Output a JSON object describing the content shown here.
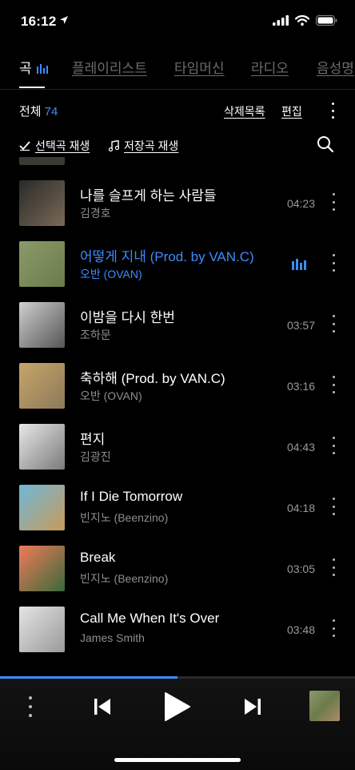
{
  "status": {
    "time": "16:12"
  },
  "tabs": [
    {
      "label": "곡"
    },
    {
      "label": "플레이리스트"
    },
    {
      "label": "타임머신"
    },
    {
      "label": "라디오"
    },
    {
      "label": "음성명"
    }
  ],
  "summary": {
    "label": "전체",
    "count": "74"
  },
  "actions": {
    "delete_list": "삭제목록",
    "edit": "편집",
    "play_selected": "선택곡 재생",
    "play_saved": "저장곡 재생"
  },
  "tracks": [
    {
      "title": "나를 슬프게 하는 사람들",
      "artist": "김경호",
      "duration": "04:23",
      "playing": false,
      "art": [
        "#2a2a2a",
        "#7a6a55"
      ]
    },
    {
      "title": "어떻게 지내 (Prod. by VAN.C)",
      "artist": "오반 (OVAN)",
      "duration": "",
      "playing": true,
      "art": [
        "#8a9a6a",
        "#6b7b4a"
      ]
    },
    {
      "title": "이밤을 다시 한번",
      "artist": "조하문",
      "duration": "03:57",
      "playing": false,
      "art": [
        "#cfcfcf",
        "#555555"
      ]
    },
    {
      "title": "축하해 (Prod. by VAN.C)",
      "artist": "오반 (OVAN)",
      "duration": "03:16",
      "playing": false,
      "art": [
        "#c9a46a",
        "#8a7a5a"
      ]
    },
    {
      "title": "편지",
      "artist": "김광진",
      "duration": "04:43",
      "playing": false,
      "art": [
        "#e8e8e8",
        "#7a7a7a"
      ]
    },
    {
      "title": "If I Die Tomorrow",
      "artist": "빈지노 (Beenzino)",
      "duration": "04:18",
      "playing": false,
      "art": [
        "#6fb8d8",
        "#c89a5a"
      ]
    },
    {
      "title": "Break",
      "artist": "빈지노 (Beenzino)",
      "duration": "03:05",
      "playing": false,
      "art": [
        "#f07a5a",
        "#3a6a3a"
      ]
    },
    {
      "title": "Call Me When It's Over",
      "artist": "James Smith",
      "duration": "03:48",
      "playing": false,
      "art": [
        "#e4e4e4",
        "#9a9a9a"
      ]
    }
  ],
  "player": {
    "progress": 0.5
  },
  "colors": {
    "accent": "#3d8bff",
    "background": "#000000"
  }
}
